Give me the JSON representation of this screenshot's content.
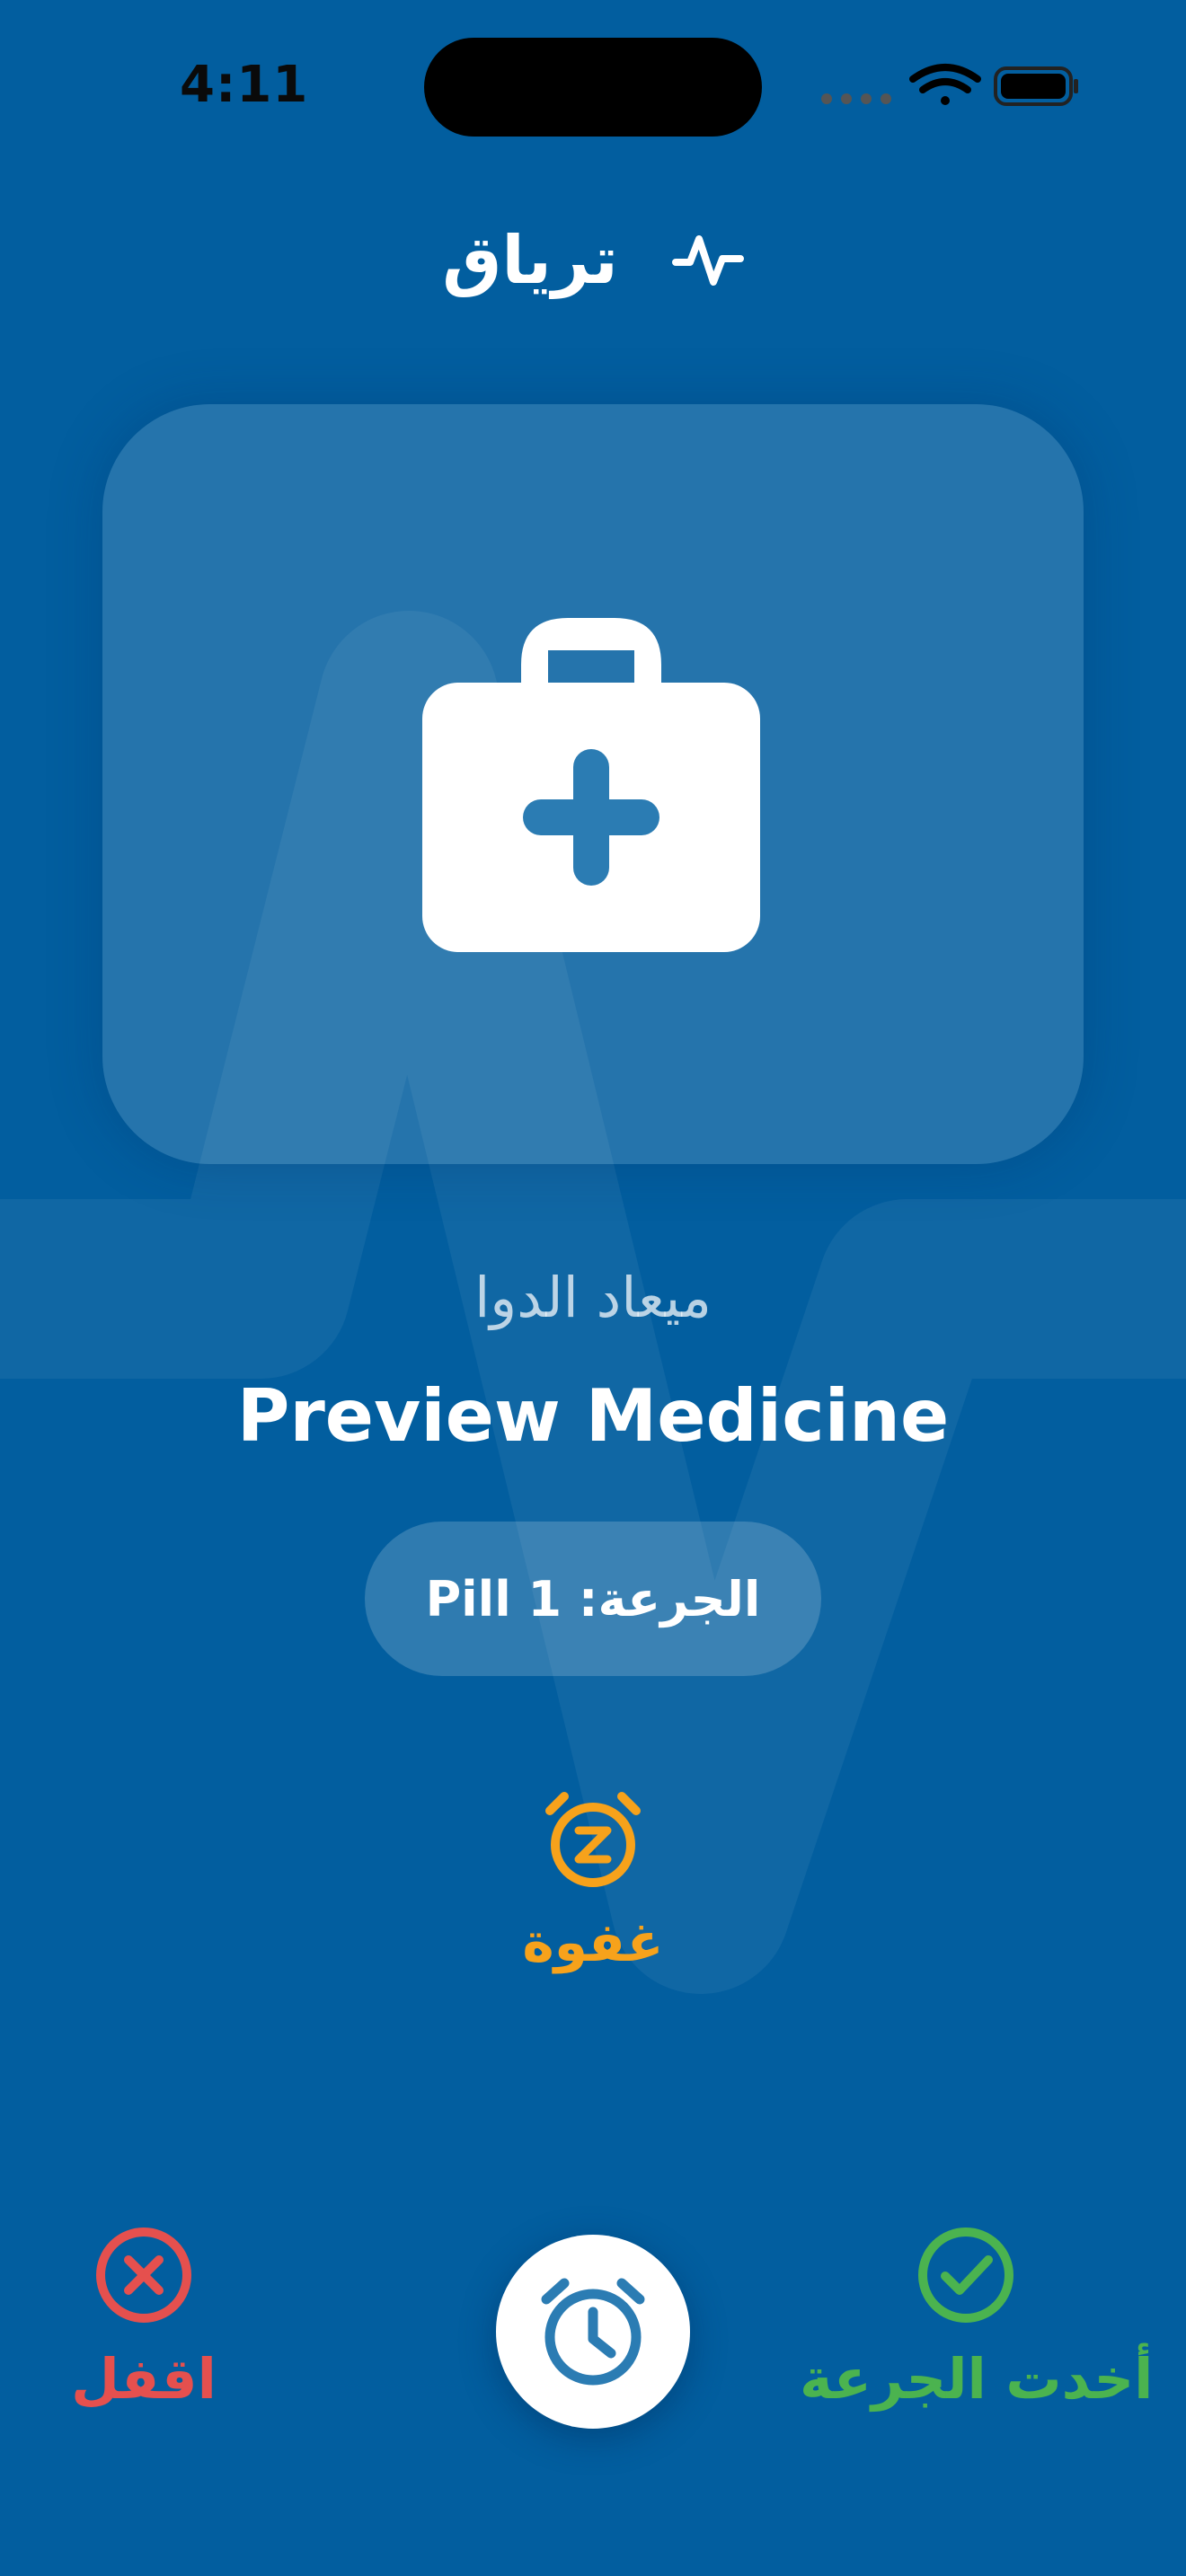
{
  "status_bar": {
    "time": "4:11"
  },
  "header": {
    "title": "ترياق",
    "icon": "pulse-icon"
  },
  "hero": {
    "icon": "medical-kit-icon"
  },
  "reminder": {
    "subtitle": "ميعاد الدوا",
    "medicine_name": "Preview Medicine",
    "dose": "الجرعة: 1 Pill"
  },
  "snooze": {
    "label": "غفوة",
    "icon": "snooze-alarm-icon",
    "color": "#f7a21b"
  },
  "actions": {
    "close": {
      "label": "اقفل",
      "icon": "close-circle-icon",
      "color": "#e5504e"
    },
    "alarm": {
      "icon": "alarm-clock-icon"
    },
    "taken": {
      "label": "أخدت الجرعة",
      "icon": "check-circle-icon",
      "color": "#4bb34f"
    }
  },
  "colors": {
    "background": "#025e9f",
    "accent": "#2b7cb3"
  }
}
